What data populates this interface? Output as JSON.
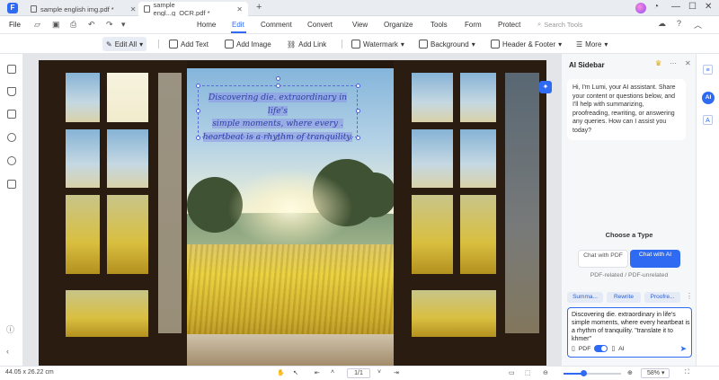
{
  "app": {
    "logo": "F",
    "tabs": [
      {
        "label": "sample english img.pdf *",
        "active": false
      },
      {
        "label": "sample engl...g_OCR.pdf *",
        "active": true
      }
    ],
    "new_tab": "+"
  },
  "menubar": {
    "file": "File",
    "items": [
      "Home",
      "Edit",
      "Comment",
      "Convert",
      "View",
      "Organize",
      "Tools",
      "Form",
      "Protect"
    ],
    "active": "Edit",
    "search_placeholder": "Search Tools"
  },
  "toolbar": {
    "edit_all": "Edit All",
    "add_text": "Add Text",
    "add_image": "Add Image",
    "add_link": "Add Link",
    "watermark": "Watermark",
    "background": "Background",
    "header_footer": "Header & Footer",
    "more": "More"
  },
  "document": {
    "text_lines": [
      "Discovering die. extraordinary in life's",
      "simple moments, where every .",
      "heartbeat is a rhythm of tranquility."
    ]
  },
  "ai_sidebar": {
    "title": "AI Sidebar",
    "greeting": "Hi, I'm Lumi, your AI assistant. Share your content or questions below, and I'll help with summarizing, proofreading, rewriting, or answering any queries. How can I assist you today?",
    "choose_type": "Choose a Type",
    "option_pdf": "Chat with PDF",
    "option_ai": "Chat with AI",
    "option_note": "PDF-related / PDF-unrelated",
    "chips": [
      "Summa...",
      "Rewrite",
      "Proofre..."
    ],
    "input_text": "Discovering die. extraordinary in life's simple moments, where every heartbeat is a rhythm of tranquility. \"translate it to khmer\"",
    "toggle_left": "PDF",
    "toggle_right": "AI"
  },
  "right_rail": {
    "ai_badge": "AI"
  },
  "statusbar": {
    "dimensions": "44.05 x 26.22 cm",
    "page": "1/1",
    "zoom": "58%",
    "zoom_fraction": 0.34
  }
}
